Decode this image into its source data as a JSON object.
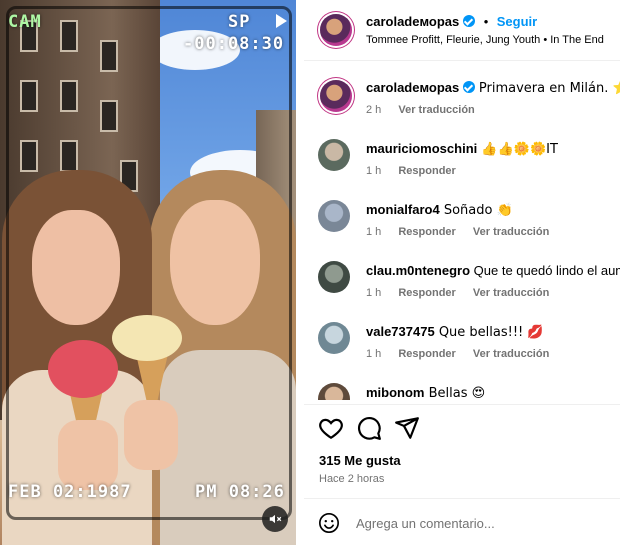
{
  "media": {
    "overlay": {
      "cam": "CAM",
      "sp": "SP",
      "timer": "-00:08:30",
      "date": "FEB 02:1987",
      "clock": "PM 08:26"
    },
    "mute_icon": "speaker-muted-icon"
  },
  "post": {
    "author": "caroladeморas",
    "author_display": "caroladeморas",
    "follow_label": "Seguir",
    "separator": "•",
    "music": "Tommee Profitt, Fleurie, Jung Youth • In The End",
    "caption": "Primavera en Milán. ⭐",
    "caption_time": "2 h",
    "caption_translate": "Ver traducción"
  },
  "comments": [
    {
      "user": "mauriciomoschini",
      "text": " 👍👍🌼🌼IT",
      "time": "1 h",
      "reply": "Responder",
      "translate": ""
    },
    {
      "user": "monialfaro4",
      "text": " Soñado 👏",
      "time": "1 h",
      "reply": "Responder",
      "translate": "Ver traducción"
    },
    {
      "user": "clau.m0ntenegro",
      "text": " Que te quedó lindo el aum",
      "time": "1 h",
      "reply": "Responder",
      "translate": "Ver traducción"
    },
    {
      "user": "vale737475",
      "text": " Que bellas!!! 💋",
      "time": "1 h",
      "reply": "Responder",
      "translate": "Ver traducción"
    },
    {
      "user": "mibonom",
      "text": " Bellas 😍",
      "time": "",
      "reply": "",
      "translate": ""
    }
  ],
  "actions": {
    "icons": [
      "heart-icon",
      "comment-icon",
      "share-icon"
    ]
  },
  "likes": "315 Me gusta",
  "ago": "Hace 2 horas",
  "add_comment_placeholder": "Agrega un comentario...",
  "colors": {
    "accent": "#0095f6",
    "muted": "#737373",
    "border": "#efefef"
  }
}
